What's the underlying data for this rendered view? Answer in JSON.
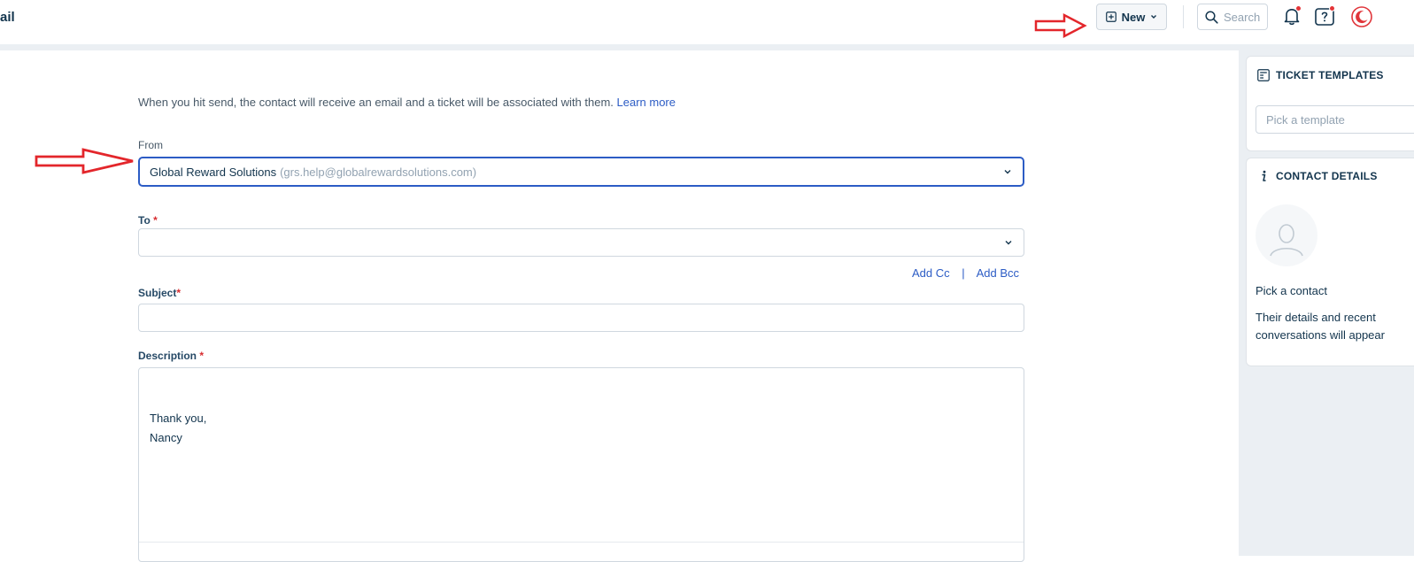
{
  "header": {
    "title": "ail",
    "new_label": "New",
    "search_placeholder": "Search"
  },
  "form": {
    "intro_text": "When you hit send, the contact will receive an email and a ticket will be associated with them.",
    "learn_more": "Learn more",
    "from_label": "From",
    "from_name": "Global Reward Solutions",
    "from_email": "(grs.help@globalrewardsolutions.com)",
    "to_label": "To",
    "add_cc": "Add Cc",
    "cc_separator": "|",
    "add_bcc": "Add Bcc",
    "subject_label": "Subject",
    "description_label": "Description",
    "required_mark": "*",
    "description_lines": [
      "Thank you,",
      "Nancy"
    ]
  },
  "sidebar": {
    "templates_title": "TICKET TEMPLATES",
    "template_placeholder": "Pick a template",
    "contact_title": "CONTACT DETAILS",
    "pick_contact": "Pick a contact",
    "their_details_1": "Their details and recent",
    "their_details_2": "conversations will appear"
  },
  "colors": {
    "accent": "#2c5cc5",
    "annotation_arrow": "#e3262b",
    "notification_dot": "#e43538",
    "brand_logo": "#e0353a"
  },
  "icons": {
    "new_button": "plus-square-icon",
    "search": "search-icon",
    "notifications": "bell-icon",
    "help": "help-icon",
    "logo": "crescent-logo-icon",
    "templates": "template-icon",
    "contact": "info-icon",
    "avatar": "person-icon"
  }
}
